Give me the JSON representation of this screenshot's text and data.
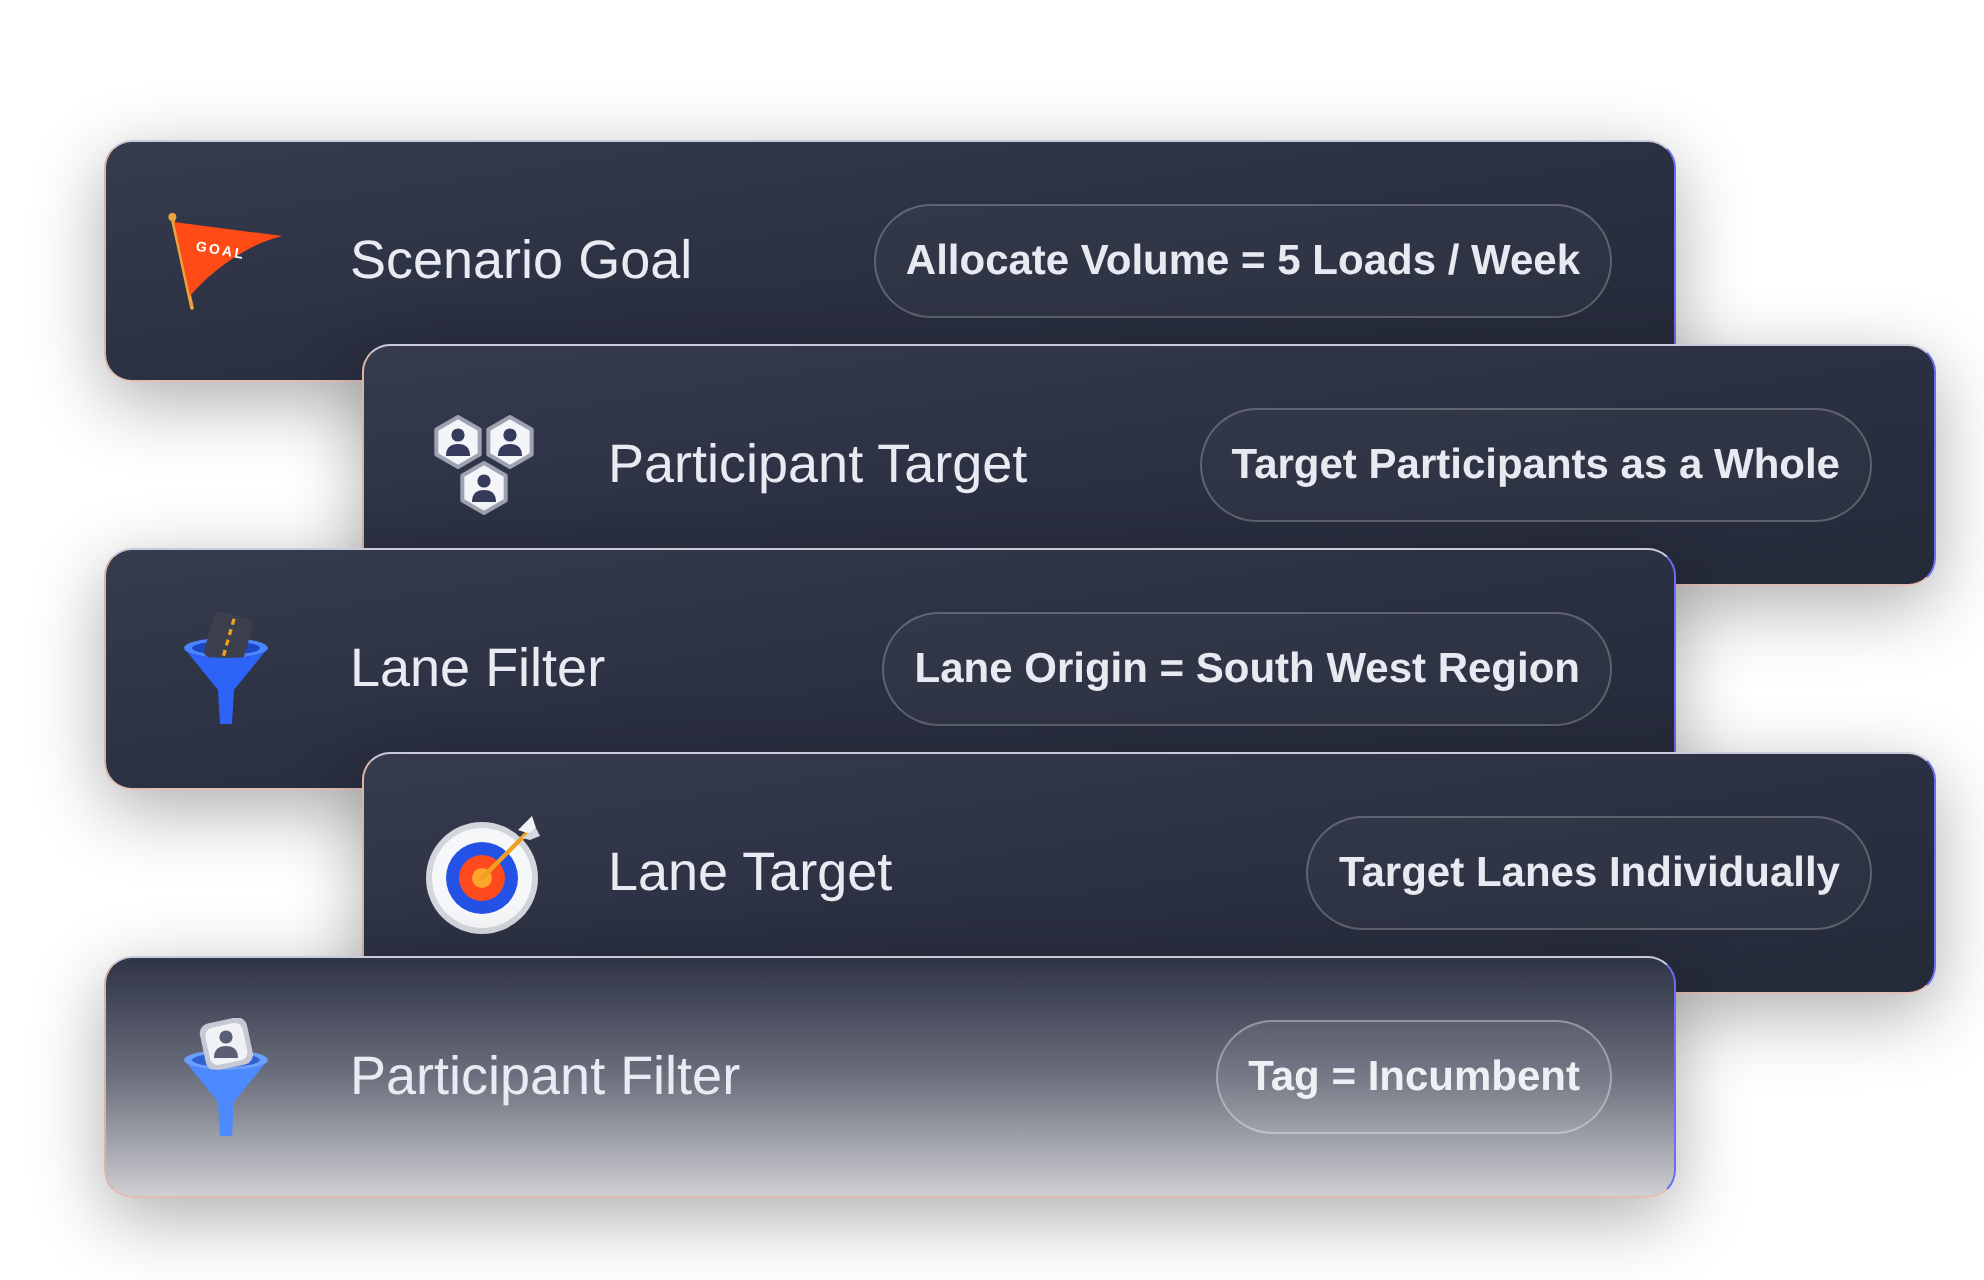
{
  "cards": [
    {
      "kind": "flag",
      "flag_label": "GOAL",
      "title": "Scenario Goal",
      "value": "Allocate Volume = 5 Loads / Week"
    },
    {
      "kind": "people",
      "title": "Participant Target",
      "value": "Target Participants as a Whole"
    },
    {
      "kind": "roadfunnel",
      "title": "Lane Filter",
      "value": "Lane Origin = South West Region"
    },
    {
      "kind": "target",
      "title": "Lane Target",
      "value": "Target Lanes Individually"
    },
    {
      "kind": "personfunnel",
      "title": "Participant Filter",
      "value": "Tag = Incumbent"
    }
  ]
}
